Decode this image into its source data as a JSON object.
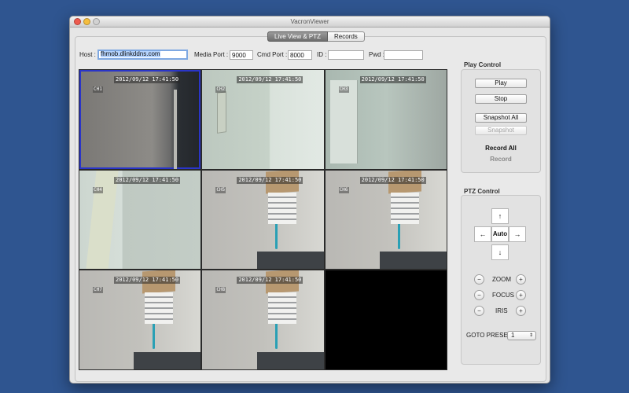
{
  "window": {
    "title": "VacronViewer"
  },
  "tabs": [
    {
      "label": "Live View & PTZ"
    },
    {
      "label": "Records"
    }
  ],
  "connection": {
    "host_label": "Host :",
    "host_value": "fhmob.dlinkddns.com",
    "media_port_label": "Media Port :",
    "media_port_value": "9000",
    "cmd_port_label": "Cmd Port :",
    "cmd_port_value": "8000",
    "id_label": "ID :",
    "id_value": "",
    "pwd_label": "Pwd :",
    "pwd_value": ""
  },
  "cameras": [
    {
      "timestamp": "2012/09/12 17:41:50",
      "channel": "CH1"
    },
    {
      "timestamp": "2012/09/12 17:41:50",
      "channel": "CH2"
    },
    {
      "timestamp": "2012/09/12 17:41:50",
      "channel": "CH3"
    },
    {
      "timestamp": "2012/09/12 17:41:50",
      "channel": "CH4"
    },
    {
      "timestamp": "2012/09/12 17:41:50",
      "channel": "CH5"
    },
    {
      "timestamp": "2012/09/12 17:41:50",
      "channel": "CH6"
    },
    {
      "timestamp": "2012/09/12 17:41:50",
      "channel": "CH7"
    },
    {
      "timestamp": "2012/09/12 17:41:50",
      "channel": "CH8"
    }
  ],
  "play_control": {
    "title": "Play Control",
    "play": "Play",
    "stop": "Stop",
    "snapshot_all": "Snapshot All",
    "snapshot": "Snapshot",
    "record_all": "Record All",
    "record": "Record"
  },
  "ptz_control": {
    "title": "PTZ Control",
    "up": "↑",
    "down": "↓",
    "left": "←",
    "right": "→",
    "auto": "Auto",
    "zoom": "ZOOM",
    "focus": "FOCUS",
    "iris": "IRIS",
    "minus": "−",
    "plus": "+",
    "goto_preset_label": "GOTO PRESET :",
    "goto_preset_value": "1",
    "select_arrow": "⇕"
  }
}
